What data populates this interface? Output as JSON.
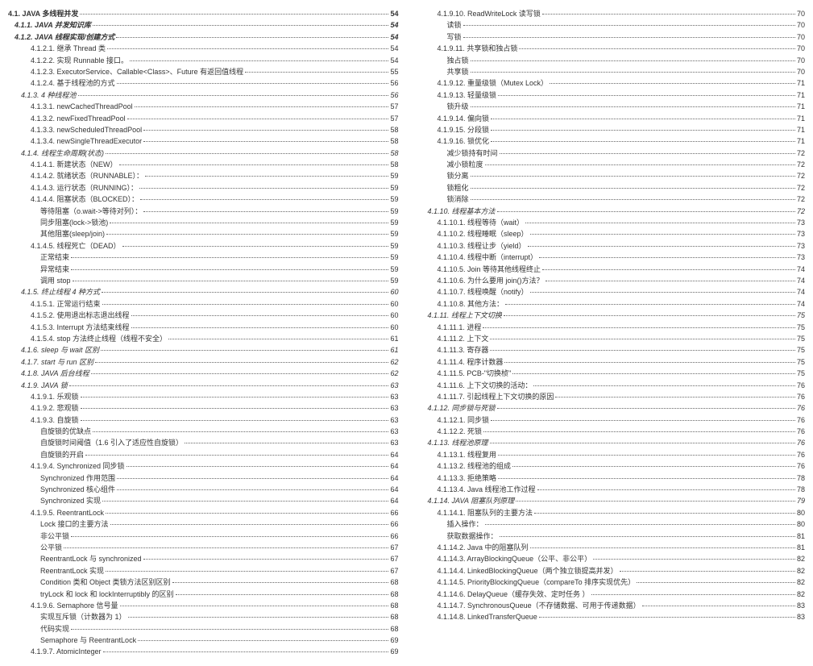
{
  "left": [
    {
      "lvl": "l0",
      "t": "4.1. JAVA 多线程并发",
      "p": "54"
    },
    {
      "lvl": "l1",
      "t": "4.1.1. JAVA 并发知识库",
      "p": "54"
    },
    {
      "lvl": "l1",
      "t": "4.1.2. JAVA 线程实现/创建方式",
      "p": "54"
    },
    {
      "lvl": "l3",
      "t": "4.1.2.1. 继承 Thread 类",
      "p": "54"
    },
    {
      "lvl": "l3",
      "t": "4.1.2.2. 实现 Runnable 接口。",
      "p": "54"
    },
    {
      "lvl": "l3",
      "t": "4.1.2.3. ExecutorService、Callable<Class>、Future 有返回值线程",
      "p": "55"
    },
    {
      "lvl": "l3",
      "t": "4.1.2.4. 基于线程池的方式",
      "p": "56"
    },
    {
      "lvl": "l2",
      "t": "4.1.3. 4 种线程池",
      "p": "56"
    },
    {
      "lvl": "l3",
      "t": "4.1.3.1. newCachedThreadPool",
      "p": "57"
    },
    {
      "lvl": "l3",
      "t": "4.1.3.2. newFixedThreadPool",
      "p": "57"
    },
    {
      "lvl": "l3",
      "t": "4.1.3.3. newScheduledThreadPool",
      "p": "58"
    },
    {
      "lvl": "l3",
      "t": "4.1.3.4. newSingleThreadExecutor",
      "p": "58"
    },
    {
      "lvl": "l2",
      "t": "4.1.4. 线程生命周期(状态)",
      "p": "58"
    },
    {
      "lvl": "l3",
      "t": "4.1.4.1. 新建状态（NEW）",
      "p": "58"
    },
    {
      "lvl": "l3",
      "t": "4.1.4.2. 就绪状态（RUNNABLE）：",
      "p": "59"
    },
    {
      "lvl": "l3",
      "t": "4.1.4.3. 运行状态（RUNNING）：",
      "p": "59"
    },
    {
      "lvl": "l3",
      "t": "4.1.4.4. 阻塞状态（BLOCKED）：",
      "p": "59"
    },
    {
      "lvl": "l4",
      "t": "等待阻塞（o.wait->等待对列）：",
      "p": "59"
    },
    {
      "lvl": "l4",
      "t": "同步阻塞(lock->锁池)",
      "p": "59"
    },
    {
      "lvl": "l4",
      "t": "其他阻塞(sleep/join)",
      "p": "59"
    },
    {
      "lvl": "l3",
      "t": "4.1.4.5. 线程死亡（DEAD）",
      "p": "59"
    },
    {
      "lvl": "l4",
      "t": "正常结束",
      "p": "59"
    },
    {
      "lvl": "l4",
      "t": "异常结束",
      "p": "59"
    },
    {
      "lvl": "l4",
      "t": "调用 stop",
      "p": "59"
    },
    {
      "lvl": "l2",
      "t": "4.1.5. 终止线程 4 种方式",
      "p": "60"
    },
    {
      "lvl": "l3",
      "t": "4.1.5.1. 正常运行结束",
      "p": "60"
    },
    {
      "lvl": "l3",
      "t": "4.1.5.2. 使用退出标志退出线程",
      "p": "60"
    },
    {
      "lvl": "l3",
      "t": "4.1.5.3. Interrupt 方法结束线程",
      "p": "60"
    },
    {
      "lvl": "l3",
      "t": "4.1.5.4. stop 方法终止线程（线程不安全）",
      "p": "61"
    },
    {
      "lvl": "l2",
      "t": "4.1.6. sleep 与 wait 区别",
      "p": "61"
    },
    {
      "lvl": "l2",
      "t": "4.1.7. start 与 run 区别",
      "p": "62"
    },
    {
      "lvl": "l2",
      "t": "4.1.8. JAVA 后台线程",
      "p": "62"
    },
    {
      "lvl": "l2",
      "t": "4.1.9. JAVA 锁",
      "p": "63"
    },
    {
      "lvl": "l3",
      "t": "4.1.9.1. 乐观锁",
      "p": "63"
    },
    {
      "lvl": "l3",
      "t": "4.1.9.2. 悲观锁",
      "p": "63"
    },
    {
      "lvl": "l3",
      "t": "4.1.9.3. 自旋锁",
      "p": "63"
    },
    {
      "lvl": "l4",
      "t": "自旋锁的优缺点",
      "p": "63"
    },
    {
      "lvl": "l4",
      "t": "自旋锁时间阈值（1.6 引入了适应性自旋锁）",
      "p": "63"
    },
    {
      "lvl": "l4",
      "t": "自旋锁的开启",
      "p": "64"
    },
    {
      "lvl": "l3",
      "t": "4.1.9.4. Synchronized 同步锁",
      "p": "64"
    },
    {
      "lvl": "l4",
      "t": "Synchronized 作用范围",
      "p": "64"
    },
    {
      "lvl": "l4",
      "t": "Synchronized 核心组件",
      "p": "64"
    },
    {
      "lvl": "l4",
      "t": "Synchronized 实现",
      "p": "64"
    },
    {
      "lvl": "l3",
      "t": "4.1.9.5. ReentrantLock",
      "p": "66"
    },
    {
      "lvl": "l4",
      "t": "Lock 接口的主要方法",
      "p": "66"
    },
    {
      "lvl": "l4",
      "t": "非公平锁",
      "p": "66"
    },
    {
      "lvl": "l4",
      "t": "公平锁",
      "p": "67"
    },
    {
      "lvl": "l4",
      "t": "ReentrantLock 与 synchronized",
      "p": "67"
    },
    {
      "lvl": "l4",
      "t": "ReentrantLock 实现",
      "p": "67"
    },
    {
      "lvl": "l4",
      "t": "Condition 类和 Object 类锁方法区别区别",
      "p": "68"
    },
    {
      "lvl": "l4",
      "t": "tryLock 和 lock 和 lockInterruptibly 的区别",
      "p": "68"
    },
    {
      "lvl": "l3",
      "t": "4.1.9.6. Semaphore 信号量",
      "p": "68"
    },
    {
      "lvl": "l4",
      "t": "实现互斥锁（计数器为 1）",
      "p": "68"
    },
    {
      "lvl": "l4",
      "t": "代码实现",
      "p": "68"
    },
    {
      "lvl": "l4",
      "t": "Semaphore 与 ReentrantLock",
      "p": "69"
    },
    {
      "lvl": "l3",
      "t": "4.1.9.7. AtomicInteger",
      "p": "69"
    }
  ],
  "right": [
    {
      "lvl": "l3",
      "t": "4.1.9.10. ReadWriteLock 读写锁",
      "p": "70"
    },
    {
      "lvl": "l4",
      "t": "读锁",
      "p": "70"
    },
    {
      "lvl": "l4",
      "t": "写锁",
      "p": "70"
    },
    {
      "lvl": "l3",
      "t": "4.1.9.11. 共享锁和独占锁",
      "p": "70"
    },
    {
      "lvl": "l4",
      "t": "独占锁",
      "p": "70"
    },
    {
      "lvl": "l4",
      "t": "共享锁",
      "p": "70"
    },
    {
      "lvl": "l3",
      "t": "4.1.9.12. 重量级锁（Mutex Lock）",
      "p": "71"
    },
    {
      "lvl": "l3",
      "t": "4.1.9.13. 轻量级锁",
      "p": "71"
    },
    {
      "lvl": "l4",
      "t": "锁升级",
      "p": "71"
    },
    {
      "lvl": "l3",
      "t": "4.1.9.14. 偏向锁",
      "p": "71"
    },
    {
      "lvl": "l3",
      "t": "4.1.9.15. 分段锁",
      "p": "71"
    },
    {
      "lvl": "l3",
      "t": "4.1.9.16. 锁优化",
      "p": "71"
    },
    {
      "lvl": "l4",
      "t": "减少锁持有时间",
      "p": "72"
    },
    {
      "lvl": "l4",
      "t": "减小锁粒度",
      "p": "72"
    },
    {
      "lvl": "l4",
      "t": "锁分离",
      "p": "72"
    },
    {
      "lvl": "l4",
      "t": "锁粗化",
      "p": "72"
    },
    {
      "lvl": "l4",
      "t": "锁消除",
      "p": "72"
    },
    {
      "lvl": "l2",
      "t": "4.1.10. 线程基本方法",
      "p": "72"
    },
    {
      "lvl": "l3",
      "t": "4.1.10.1. 线程等待（wait）",
      "p": "73"
    },
    {
      "lvl": "l3",
      "t": "4.1.10.2. 线程睡眠（sleep）",
      "p": "73"
    },
    {
      "lvl": "l3",
      "t": "4.1.10.3. 线程让步（yield）",
      "p": "73"
    },
    {
      "lvl": "l3",
      "t": "4.1.10.4. 线程中断（interrupt）",
      "p": "73"
    },
    {
      "lvl": "l3",
      "t": "4.1.10.5. Join 等待其他线程终止",
      "p": "74"
    },
    {
      "lvl": "l3",
      "t": "4.1.10.6. 为什么要用 join()方法？",
      "p": "74"
    },
    {
      "lvl": "l3",
      "t": "4.1.10.7. 线程唤醒（notify）",
      "p": "74"
    },
    {
      "lvl": "l3",
      "t": "4.1.10.8. 其他方法：",
      "p": "74"
    },
    {
      "lvl": "l2",
      "t": "4.1.11. 线程上下文切换",
      "p": "75"
    },
    {
      "lvl": "l3",
      "t": "4.1.11.1. 进程",
      "p": "75"
    },
    {
      "lvl": "l3",
      "t": "4.1.11.2. 上下文",
      "p": "75"
    },
    {
      "lvl": "l3",
      "t": "4.1.11.3. 寄存器",
      "p": "75"
    },
    {
      "lvl": "l3",
      "t": "4.1.11.4. 程序计数器",
      "p": "75"
    },
    {
      "lvl": "l3",
      "t": "4.1.11.5. PCB-\"切换桢\"",
      "p": "75"
    },
    {
      "lvl": "l3",
      "t": "4.1.11.6. 上下文切换的活动：",
      "p": "76"
    },
    {
      "lvl": "l3",
      "t": "4.1.11.7. 引起线程上下文切换的原因",
      "p": "76"
    },
    {
      "lvl": "l2",
      "t": "4.1.12. 同步锁与死锁",
      "p": "76"
    },
    {
      "lvl": "l3",
      "t": "4.1.12.1. 同步锁",
      "p": "76"
    },
    {
      "lvl": "l3",
      "t": "4.1.12.2. 死锁",
      "p": "76"
    },
    {
      "lvl": "l2",
      "t": "4.1.13. 线程池原理",
      "p": "76"
    },
    {
      "lvl": "l3",
      "t": "4.1.13.1. 线程复用",
      "p": "76"
    },
    {
      "lvl": "l3",
      "t": "4.1.13.2. 线程池的组成",
      "p": "76"
    },
    {
      "lvl": "l3",
      "t": "4.1.13.3. 拒绝策略",
      "p": "78"
    },
    {
      "lvl": "l3",
      "t": "4.1.13.4. Java 线程池工作过程",
      "p": "78"
    },
    {
      "lvl": "l2",
      "t": "4.1.14. JAVA 阻塞队列原理",
      "p": "79"
    },
    {
      "lvl": "l3",
      "t": "4.1.14.1. 阻塞队列的主要方法",
      "p": "80"
    },
    {
      "lvl": "l4",
      "t": "插入操作：",
      "p": "80"
    },
    {
      "lvl": "l4",
      "t": "获取数据操作：",
      "p": "81"
    },
    {
      "lvl": "l3",
      "t": "4.1.14.2. Java 中的阻塞队列",
      "p": "81"
    },
    {
      "lvl": "l3",
      "t": "4.1.14.3. ArrayBlockingQueue（公平、非公平）",
      "p": "82"
    },
    {
      "lvl": "l3",
      "t": "4.1.14.4. LinkedBlockingQueue（两个独立锁提高并发）",
      "p": "82"
    },
    {
      "lvl": "l3",
      "t": "4.1.14.5. PriorityBlockingQueue（compareTo 排序实现优先）",
      "p": "82"
    },
    {
      "lvl": "l3",
      "t": "4.1.14.6. DelayQueue（缓存失效、定时任务 ）",
      "p": "82"
    },
    {
      "lvl": "l3",
      "t": "4.1.14.7. SynchronousQueue（不存储数据、可用于传递数据）",
      "p": "83"
    },
    {
      "lvl": "l3",
      "t": "4.1.14.8. LinkedTransferQueue",
      "p": "83"
    }
  ]
}
